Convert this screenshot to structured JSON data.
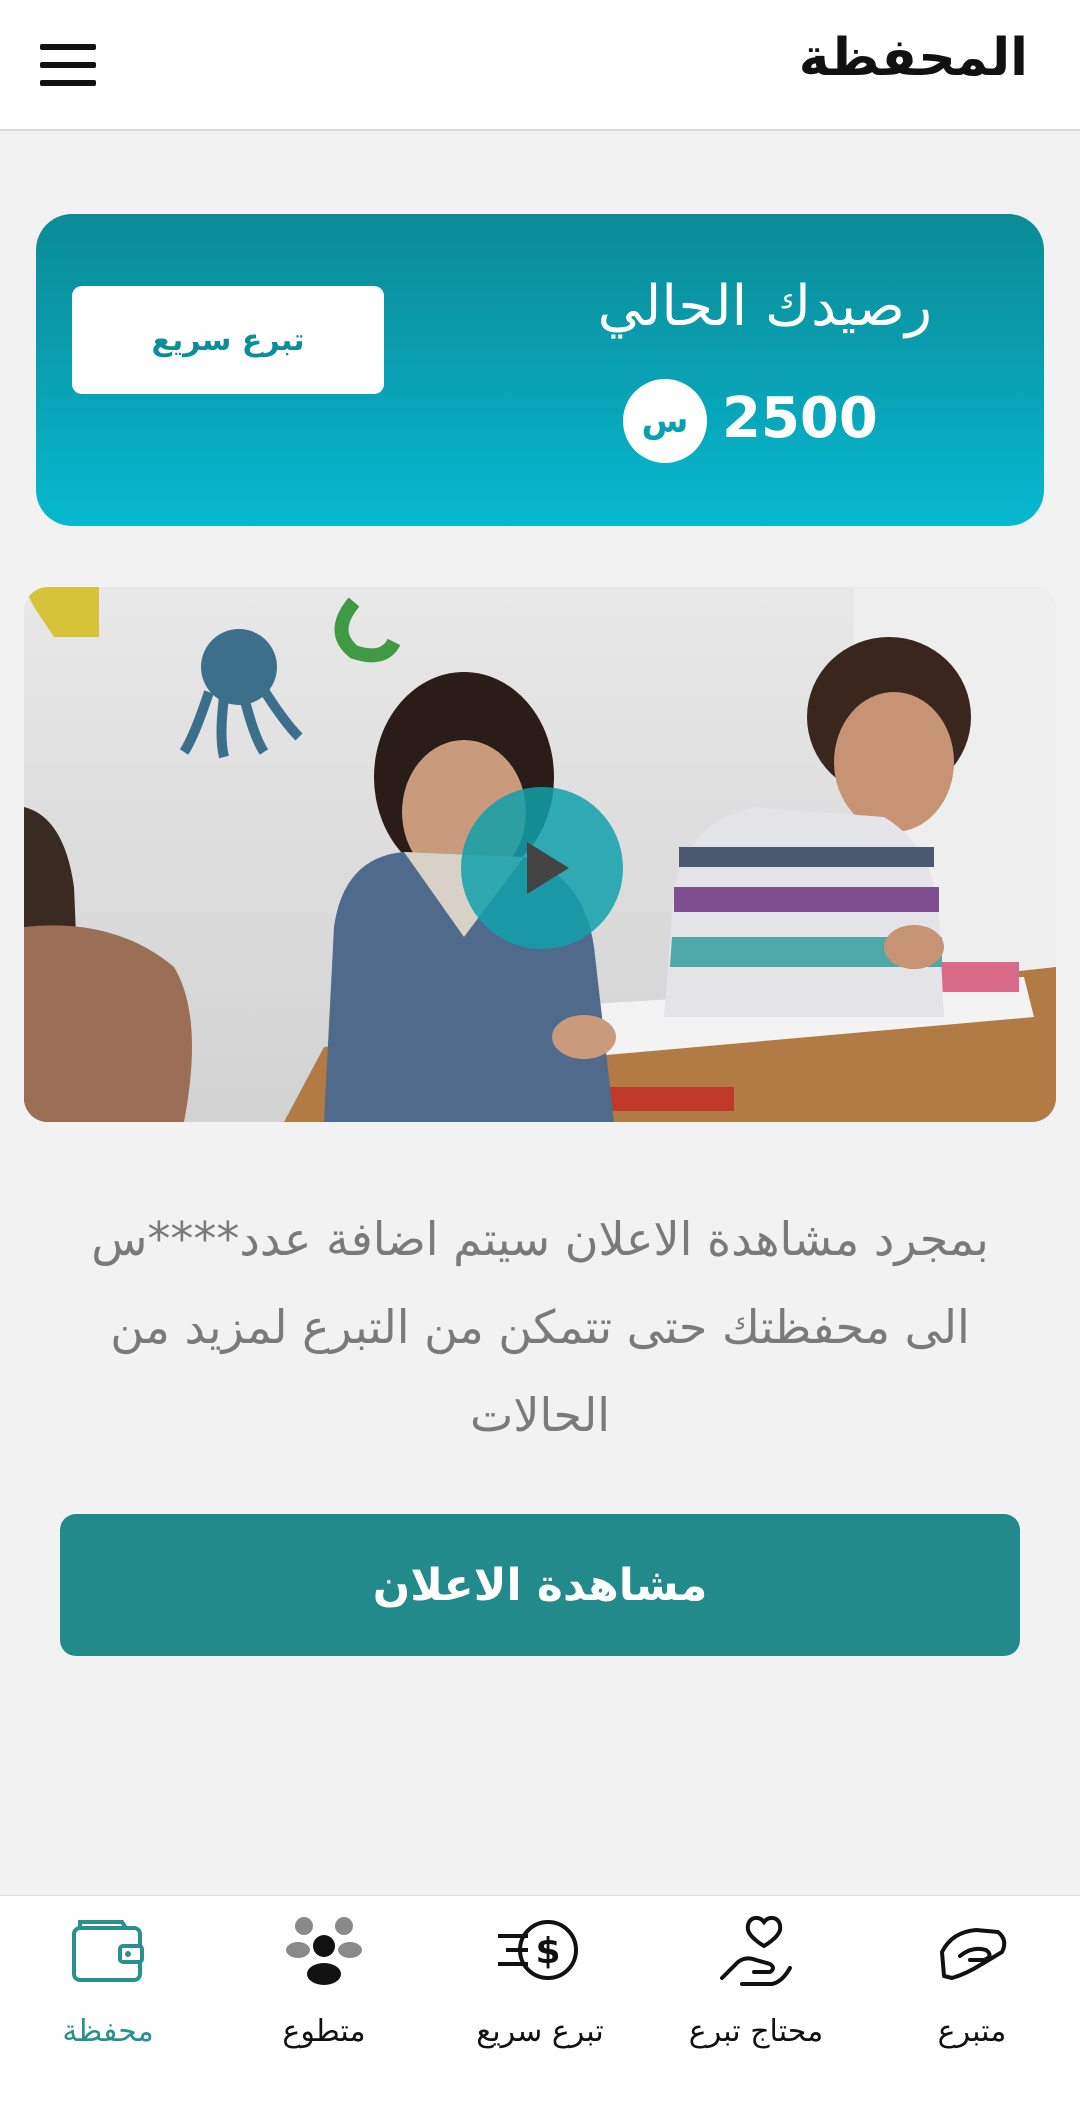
{
  "header": {
    "title": "المحفظة",
    "menu_icon": "hamburger-menu-icon"
  },
  "balance": {
    "title": "رصيدك الحالي",
    "amount": "2500",
    "currency_symbol": "س",
    "quick_donate_label": "تبرع سريع"
  },
  "video": {
    "play_icon": "play-icon"
  },
  "info_text": "بمجرد مشاهدة الاعلان سيتم اضافة عدد****س الى محفظتك حتى تتمكن من التبرع لمزيد من الحالات",
  "watch_ad_label": "مشاهدة الاعلان",
  "bottom_nav": {
    "items": [
      {
        "label": "محفظة",
        "icon": "wallet-icon",
        "active": true
      },
      {
        "label": "متطوع",
        "icon": "volunteer-group-icon",
        "active": false
      },
      {
        "label": "تبرع سريع",
        "icon": "fast-dollar-icon",
        "active": false
      },
      {
        "label": "محتاج تبرع",
        "icon": "heart-hand-icon",
        "active": false
      },
      {
        "label": "متبرع",
        "icon": "giving-hand-icon",
        "active": false
      }
    ]
  },
  "colors": {
    "accent": "#228a8a",
    "card_top": "#0b8b96",
    "card_bottom": "#06b9d0",
    "active_nav": "#2a8f8f"
  }
}
